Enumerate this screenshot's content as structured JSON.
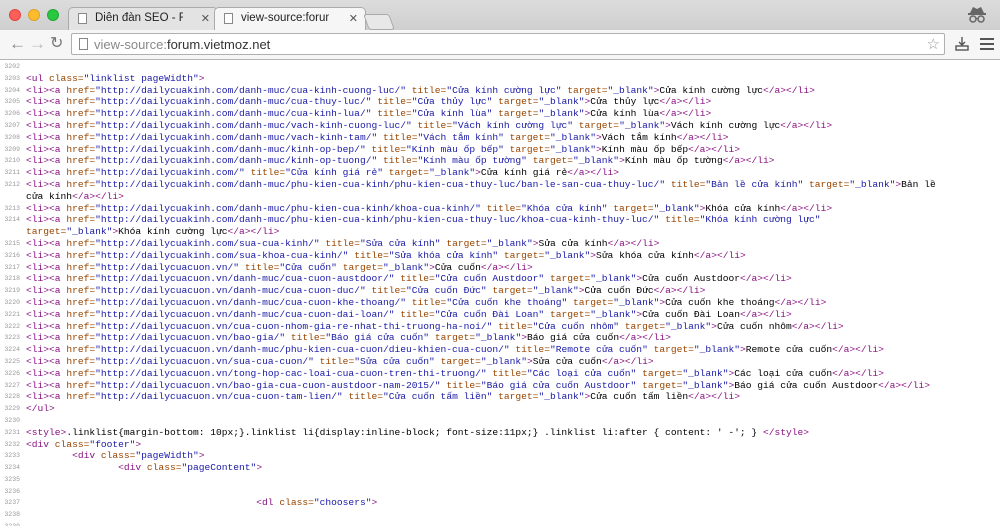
{
  "browser": {
    "tabs": [
      {
        "title": "Diễn đàn SEO - Forum SEO",
        "active": false
      },
      {
        "title": "view-source:forum.vietmoz",
        "active": true
      }
    ],
    "address": {
      "scheme": "view-source:",
      "host": "forum.vietmoz.net"
    }
  },
  "source": {
    "lines": [
      {
        "n": "3202",
        "html": ""
      },
      {
        "n": "3203",
        "html": "<span class=\"tag\">&lt;ul</span> <span class=\"attr\">class=</span><span class=\"val\">\"linklist pageWidth\"</span><span class=\"tag\">&gt;</span>"
      },
      {
        "n": "3204",
        "html": "<span class=\"tag\">&lt;li&gt;&lt;a</span> <span class=\"attr\">href=</span><span class=\"val\">\"http://dailycuakinh.com/danh-muc/cua-kinh-cuong-luc/\"</span> <span class=\"attr\">title=</span><span class=\"val\">\"Cửa kính cường lực\"</span> <span class=\"attr\">target=</span><span class=\"val\">\"_blank\"</span><span class=\"tag\">&gt;</span>Cửa kính cường lực<span class=\"tag\">&lt;/a&gt;&lt;/li&gt;</span>"
      },
      {
        "n": "3205",
        "html": "<span class=\"tag\">&lt;li&gt;&lt;a</span> <span class=\"attr\">href=</span><span class=\"val\">\"http://dailycuakinh.com/danh-muc/cua-thuy-luc/\"</span> <span class=\"attr\">title=</span><span class=\"val\">\"Cửa thủy lực\"</span> <span class=\"attr\">target=</span><span class=\"val\">\"_blank\"</span><span class=\"tag\">&gt;</span>Cửa thủy lực<span class=\"tag\">&lt;/a&gt;&lt;/li&gt;</span>"
      },
      {
        "n": "3206",
        "html": "<span class=\"tag\">&lt;li&gt;&lt;a</span> <span class=\"attr\">href=</span><span class=\"val\">\"http://dailycuakinh.com/danh-muc/cua-kinh-lua/\"</span> <span class=\"attr\">title=</span><span class=\"val\">\"Cửa kính lùa\"</span> <span class=\"attr\">target=</span><span class=\"val\">\"_blank\"</span><span class=\"tag\">&gt;</span>Cửa kính lùa<span class=\"tag\">&lt;/a&gt;&lt;/li&gt;</span>"
      },
      {
        "n": "3207",
        "html": "<span class=\"tag\">&lt;li&gt;&lt;a</span> <span class=\"attr\">href=</span><span class=\"val\">\"http://dailycuakinh.com/danh-muc/vach-kinh-cuong-luc/\"</span> <span class=\"attr\">title=</span><span class=\"val\">\"Vách kính cường lực\"</span> <span class=\"attr\">target=</span><span class=\"val\">\"_blank\"</span><span class=\"tag\">&gt;</span>Vách kính cường lực<span class=\"tag\">&lt;/a&gt;&lt;/li&gt;</span>"
      },
      {
        "n": "3208",
        "html": "<span class=\"tag\">&lt;li&gt;&lt;a</span> <span class=\"attr\">href=</span><span class=\"val\">\"http://dailycuakinh.com/danh-muc/vach-kinh-tam/\"</span> <span class=\"attr\">title=</span><span class=\"val\">\"Vách tắm kính\"</span> <span class=\"attr\">target=</span><span class=\"val\">\"_blank\"</span><span class=\"tag\">&gt;</span>Vách tắm kính<span class=\"tag\">&lt;/a&gt;&lt;/li&gt;</span>"
      },
      {
        "n": "3209",
        "html": "<span class=\"tag\">&lt;li&gt;&lt;a</span> <span class=\"attr\">href=</span><span class=\"val\">\"http://dailycuakinh.com/danh-muc/kinh-op-bep/\"</span> <span class=\"attr\">title=</span><span class=\"val\">\"Kính màu ốp bếp\"</span> <span class=\"attr\">target=</span><span class=\"val\">\"_blank\"</span><span class=\"tag\">&gt;</span>Kính màu ốp bếp<span class=\"tag\">&lt;/a&gt;&lt;/li&gt;</span>"
      },
      {
        "n": "3210",
        "html": "<span class=\"tag\">&lt;li&gt;&lt;a</span> <span class=\"attr\">href=</span><span class=\"val\">\"http://dailycuakinh.com/danh-muc/kinh-op-tuong/\"</span> <span class=\"attr\">title=</span><span class=\"val\">\"Kính màu ốp tường\"</span> <span class=\"attr\">target=</span><span class=\"val\">\"_blank\"</span><span class=\"tag\">&gt;</span>Kính màu ốp tường<span class=\"tag\">&lt;/a&gt;&lt;/li&gt;</span>"
      },
      {
        "n": "3211",
        "html": "<span class=\"tag\">&lt;li&gt;&lt;a</span> <span class=\"attr\">href=</span><span class=\"val\">\"http://dailycuakinh.com/\"</span> <span class=\"attr\">title=</span><span class=\"val\">\"Cửa kính giá rẻ\"</span> <span class=\"attr\">target=</span><span class=\"val\">\"_blank\"</span><span class=\"tag\">&gt;</span>Cửa kính giá rẻ<span class=\"tag\">&lt;/a&gt;&lt;/li&gt;</span>"
      },
      {
        "n": "3212",
        "html": "<span class=\"tag\">&lt;li&gt;&lt;a</span> <span class=\"attr\">href=</span><span class=\"val\">\"http://dailycuakinh.com/danh-muc/phu-kien-cua-kinh/phu-kien-cua-thuy-luc/ban-le-san-cua-thuy-luc/\"</span> <span class=\"attr\">title=</span><span class=\"val\">\"Bản lề cửa kính\"</span> <span class=\"attr\">target=</span><span class=\"val\">\"_blank\"</span><span class=\"tag\">&gt;</span>Bản lề"
      },
      {
        "n": "",
        "html": "cửa kính<span class=\"tag\">&lt;/a&gt;&lt;/li&gt;</span>"
      },
      {
        "n": "3213",
        "html": "<span class=\"tag\">&lt;li&gt;&lt;a</span> <span class=\"attr\">href=</span><span class=\"val\">\"http://dailycuakinh.com/danh-muc/phu-kien-cua-kinh/khoa-cua-kinh/\"</span> <span class=\"attr\">title=</span><span class=\"val\">\"Khóa cửa kính\"</span> <span class=\"attr\">target=</span><span class=\"val\">\"_blank\"</span><span class=\"tag\">&gt;</span>Khóa cửa kính<span class=\"tag\">&lt;/a&gt;&lt;/li&gt;</span>"
      },
      {
        "n": "3214",
        "html": "<span class=\"tag\">&lt;li&gt;&lt;a</span> <span class=\"attr\">href=</span><span class=\"val\">\"http://dailycuakinh.com/danh-muc/phu-kien-cua-kinh/phu-kien-cua-thuy-luc/khoa-cua-kinh-thuy-luc/\"</span> <span class=\"attr\">title=</span><span class=\"val\">\"Khóa kính cường lực\"</span>"
      },
      {
        "n": "",
        "html": "<span class=\"attr\">target=</span><span class=\"val\">\"_blank\"</span><span class=\"tag\">&gt;</span>Khóa kính cường lực<span class=\"tag\">&lt;/a&gt;&lt;/li&gt;</span>"
      },
      {
        "n": "3215",
        "html": "<span class=\"tag\">&lt;li&gt;&lt;a</span> <span class=\"attr\">href=</span><span class=\"val\">\"http://dailycuakinh.com/sua-cua-kinh/\"</span> <span class=\"attr\">title=</span><span class=\"val\">\"Sửa cửa kính\"</span> <span class=\"attr\">target=</span><span class=\"val\">\"_blank\"</span><span class=\"tag\">&gt;</span>Sửa cửa kính<span class=\"tag\">&lt;/a&gt;&lt;/li&gt;</span>"
      },
      {
        "n": "3216",
        "html": "<span class=\"tag\">&lt;li&gt;&lt;a</span> <span class=\"attr\">href=</span><span class=\"val\">\"http://dailycuakinh.com/sua-khoa-cua-kinh/\"</span> <span class=\"attr\">title=</span><span class=\"val\">\"Sửa khóa cửa kính\"</span> <span class=\"attr\">target=</span><span class=\"val\">\"_blank\"</span><span class=\"tag\">&gt;</span>Sửa khóa cửa kính<span class=\"tag\">&lt;/a&gt;&lt;/li&gt;</span>"
      },
      {
        "n": "3217",
        "html": "<span class=\"tag\">&lt;li&gt;&lt;a</span> <span class=\"attr\">href=</span><span class=\"val\">\"http://dailycuacuon.vn/\"</span> <span class=\"attr\">title=</span><span class=\"val\">\"Cửa cuốn\"</span> <span class=\"attr\">target=</span><span class=\"val\">\"_blank\"</span><span class=\"tag\">&gt;</span>Cửa cuốn<span class=\"tag\">&lt;/a&gt;&lt;/li&gt;</span>"
      },
      {
        "n": "3218",
        "html": "<span class=\"tag\">&lt;li&gt;&lt;a</span> <span class=\"attr\">href=</span><span class=\"val\">\"http://dailycuacuon.vn/danh-muc/cua-cuon-austdoor/\"</span> <span class=\"attr\">title=</span><span class=\"val\">\"Cửa cuốn Austdoor\"</span> <span class=\"attr\">target=</span><span class=\"val\">\"_blank\"</span><span class=\"tag\">&gt;</span>Cửa cuốn Austdoor<span class=\"tag\">&lt;/a&gt;&lt;/li&gt;</span>"
      },
      {
        "n": "3219",
        "html": "<span class=\"tag\">&lt;li&gt;&lt;a</span> <span class=\"attr\">href=</span><span class=\"val\">\"http://dailycuacuon.vn/danh-muc/cua-cuon-duc/\"</span> <span class=\"attr\">title=</span><span class=\"val\">\"Cửa cuốn Đức\"</span> <span class=\"attr\">target=</span><span class=\"val\">\"_blank\"</span><span class=\"tag\">&gt;</span>Cửa cuốn Đức<span class=\"tag\">&lt;/a&gt;&lt;/li&gt;</span>"
      },
      {
        "n": "3220",
        "html": "<span class=\"tag\">&lt;li&gt;&lt;a</span> <span class=\"attr\">href=</span><span class=\"val\">\"http://dailycuacuon.vn/danh-muc/cua-cuon-khe-thoang/\"</span> <span class=\"attr\">title=</span><span class=\"val\">\"Cửa cuốn khe thoáng\"</span> <span class=\"attr\">target=</span><span class=\"val\">\"_blank\"</span><span class=\"tag\">&gt;</span>Cửa cuốn khe thoáng<span class=\"tag\">&lt;/a&gt;&lt;/li&gt;</span>"
      },
      {
        "n": "3221",
        "html": "<span class=\"tag\">&lt;li&gt;&lt;a</span> <span class=\"attr\">href=</span><span class=\"val\">\"http://dailycuacuon.vn/danh-muc/cua-cuon-dai-loan/\"</span> <span class=\"attr\">title=</span><span class=\"val\">\"Cửa cuốn Đài Loan\"</span> <span class=\"attr\">target=</span><span class=\"val\">\"_blank\"</span><span class=\"tag\">&gt;</span>Cửa cuốn Đài Loan<span class=\"tag\">&lt;/a&gt;&lt;/li&gt;</span>"
      },
      {
        "n": "3222",
        "html": "<span class=\"tag\">&lt;li&gt;&lt;a</span> <span class=\"attr\">href=</span><span class=\"val\">\"http://dailycuacuon.vn/cua-cuon-nhom-gia-re-nhat-thi-truong-ha-noi/\"</span> <span class=\"attr\">title=</span><span class=\"val\">\"Cửa cuốn nhôm\"</span> <span class=\"attr\">target=</span><span class=\"val\">\"_blank\"</span><span class=\"tag\">&gt;</span>Cửa cuốn nhôm<span class=\"tag\">&lt;/a&gt;&lt;/li&gt;</span>"
      },
      {
        "n": "3223",
        "html": "<span class=\"tag\">&lt;li&gt;&lt;a</span> <span class=\"attr\">href=</span><span class=\"val\">\"http://dailycuacuon.vn/bao-gia/\"</span> <span class=\"attr\">title=</span><span class=\"val\">\"Báo giá cửa cuốn\"</span> <span class=\"attr\">target=</span><span class=\"val\">\"_blank\"</span><span class=\"tag\">&gt;</span>Báo giá cửa cuốn<span class=\"tag\">&lt;/a&gt;&lt;/li&gt;</span>"
      },
      {
        "n": "3224",
        "html": "<span class=\"tag\">&lt;li&gt;&lt;a</span> <span class=\"attr\">href=</span><span class=\"val\">\"http://dailycuacuon.vn/danh-muc/phu-kien-cua-cuon/dieu-khien-cua-cuon/\"</span> <span class=\"attr\">title=</span><span class=\"val\">\"Remote cửa cuốn\"</span> <span class=\"attr\">target=</span><span class=\"val\">\"_blank\"</span><span class=\"tag\">&gt;</span>Remote cửa cuốn<span class=\"tag\">&lt;/a&gt;&lt;/li&gt;</span>"
      },
      {
        "n": "3225",
        "html": "<span class=\"tag\">&lt;li&gt;&lt;a</span> <span class=\"attr\">href=</span><span class=\"val\">\"http://dailycuacuon.vn/sua-cua-cuon/\"</span> <span class=\"attr\">title=</span><span class=\"val\">\"Sửa cửa cuốn\"</span> <span class=\"attr\">target=</span><span class=\"val\">\"_blank\"</span><span class=\"tag\">&gt;</span>Sửa cửa cuốn<span class=\"tag\">&lt;/a&gt;&lt;/li&gt;</span>"
      },
      {
        "n": "3226",
        "html": "<span class=\"tag\">&lt;li&gt;&lt;a</span> <span class=\"attr\">href=</span><span class=\"val\">\"http://dailycuacuon.vn/tong-hop-cac-loai-cua-cuon-tren-thi-truong/\"</span> <span class=\"attr\">title=</span><span class=\"val\">\"Các loại cửa cuốn\"</span> <span class=\"attr\">target=</span><span class=\"val\">\"_blank\"</span><span class=\"tag\">&gt;</span>Các loại cửa cuốn<span class=\"tag\">&lt;/a&gt;&lt;/li&gt;</span>"
      },
      {
        "n": "3227",
        "html": "<span class=\"tag\">&lt;li&gt;&lt;a</span> <span class=\"attr\">href=</span><span class=\"val\">\"http://dailycuacuon.vn/bao-gia-cua-cuon-austdoor-nam-2015/\"</span> <span class=\"attr\">title=</span><span class=\"val\">\"Báo giá cửa cuốn Austdoor\"</span> <span class=\"attr\">target=</span><span class=\"val\">\"_blank\"</span><span class=\"tag\">&gt;</span>Báo giá cửa cuốn Austdoor<span class=\"tag\">&lt;/a&gt;&lt;/li&gt;</span>"
      },
      {
        "n": "3228",
        "html": "<span class=\"tag\">&lt;li&gt;&lt;a</span> <span class=\"attr\">href=</span><span class=\"val\">\"http://dailycuacuon.vn/cua-cuon-tam-lien/\"</span> <span class=\"attr\">title=</span><span class=\"val\">\"Cửa cuốn tấm liền\"</span> <span class=\"attr\">target=</span><span class=\"val\">\"_blank\"</span><span class=\"tag\">&gt;</span>Cửa cuốn tấm liền<span class=\"tag\">&lt;/a&gt;&lt;/li&gt;</span>"
      },
      {
        "n": "3229",
        "html": "<span class=\"tag\">&lt;/ul&gt;</span>"
      },
      {
        "n": "3230",
        "html": ""
      },
      {
        "n": "3231",
        "html": "<span class=\"tag\">&lt;style&gt;</span>.linklist{margin-bottom: 10px;}.linklist li{display:inline-block; font-size:11px;} .linklist li:after { content: ' -'; } <span class=\"tag\">&lt;/style&gt;</span>"
      },
      {
        "n": "3232",
        "html": "<span class=\"tag\">&lt;div</span> <span class=\"attr\">class=</span><span class=\"val\">\"footer\"</span><span class=\"tag\">&gt;</span>"
      },
      {
        "n": "3233",
        "html": "        <span class=\"tag\">&lt;div</span> <span class=\"attr\">class=</span><span class=\"val\">\"pageWidth\"</span><span class=\"tag\">&gt;</span>"
      },
      {
        "n": "3234",
        "html": "                <span class=\"tag\">&lt;div</span> <span class=\"attr\">class=</span><span class=\"val\">\"pageContent\"</span><span class=\"tag\">&gt;</span>"
      },
      {
        "n": "3235",
        "html": ""
      },
      {
        "n": "3236",
        "html": ""
      },
      {
        "n": "3237",
        "html": "                                        <span class=\"tag\">&lt;dl</span> <span class=\"attr\">class=</span><span class=\"val\">\"choosers\"</span><span class=\"tag\">&gt;</span>"
      },
      {
        "n": "3238",
        "html": ""
      },
      {
        "n": "3239",
        "html": ""
      }
    ]
  }
}
